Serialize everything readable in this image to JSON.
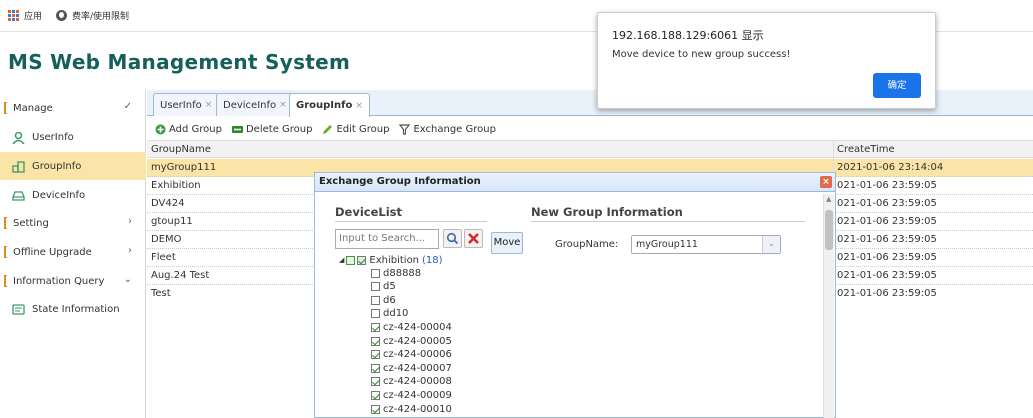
{
  "bookmarks": {
    "apps": "应用",
    "tariff": "费率/使用限制"
  },
  "app_title": "MS Web Management System",
  "sidebar": {
    "manage": "Manage",
    "userinfo": "UserInfo",
    "groupinfo": "GroupInfo",
    "deviceinfo": "DeviceInfo",
    "setting": "Setting",
    "offline_upgrade": "Offline Upgrade",
    "info_query": "Information Query",
    "state_info": "State Information"
  },
  "tabs": [
    "UserInfo",
    "DeviceInfo",
    "GroupInfo"
  ],
  "toolbar": {
    "add": "Add Group",
    "delete": "Delete Group",
    "edit": "Edit Group",
    "exchange": "Exchange Group"
  },
  "grid": {
    "headers": [
      "GroupName",
      "CreateTime"
    ],
    "rows": [
      {
        "name": "myGroup111",
        "time": "2021-01-06 23:14:04"
      },
      {
        "name": "Exhibition",
        "time": "021-01-06 23:59:05"
      },
      {
        "name": "DV424",
        "time": "021-01-06 23:59:05"
      },
      {
        "name": "gtoup11",
        "time": "021-01-06 23:59:05"
      },
      {
        "name": "DEMO",
        "time": "021-01-06 23:59:05"
      },
      {
        "name": "Fleet",
        "time": "021-01-06 23:59:05"
      },
      {
        "name": "Aug.24 Test",
        "time": "021-01-06 23:59:05"
      },
      {
        "name": "Test",
        "time": "021-01-06 23:59:05"
      }
    ]
  },
  "dialog": {
    "title": "Exchange Group Information",
    "device_list": "DeviceList",
    "new_group": "New Group Information",
    "search_placeholder": "Input to Search...",
    "move": "Move",
    "group_name_label": "GroupName:",
    "group_name_value": "myGroup111",
    "tree_root": "Exhibition",
    "tree_count": "(18)",
    "devices": [
      {
        "name": "d88888",
        "checked": false
      },
      {
        "name": "d5",
        "checked": false
      },
      {
        "name": "d6",
        "checked": false
      },
      {
        "name": "dd10",
        "checked": false
      },
      {
        "name": "cz-424-00004",
        "checked": true
      },
      {
        "name": "cz-424-00005",
        "checked": true
      },
      {
        "name": "cz-424-00006",
        "checked": true
      },
      {
        "name": "cz-424-00007",
        "checked": true
      },
      {
        "name": "cz-424-00008",
        "checked": true
      },
      {
        "name": "cz-424-00009",
        "checked": true
      },
      {
        "name": "cz-424-00010",
        "checked": true
      }
    ]
  },
  "alert": {
    "host": "192.168.188.129:6061 显示",
    "message": "Move device to new group success!",
    "ok": "确定"
  }
}
